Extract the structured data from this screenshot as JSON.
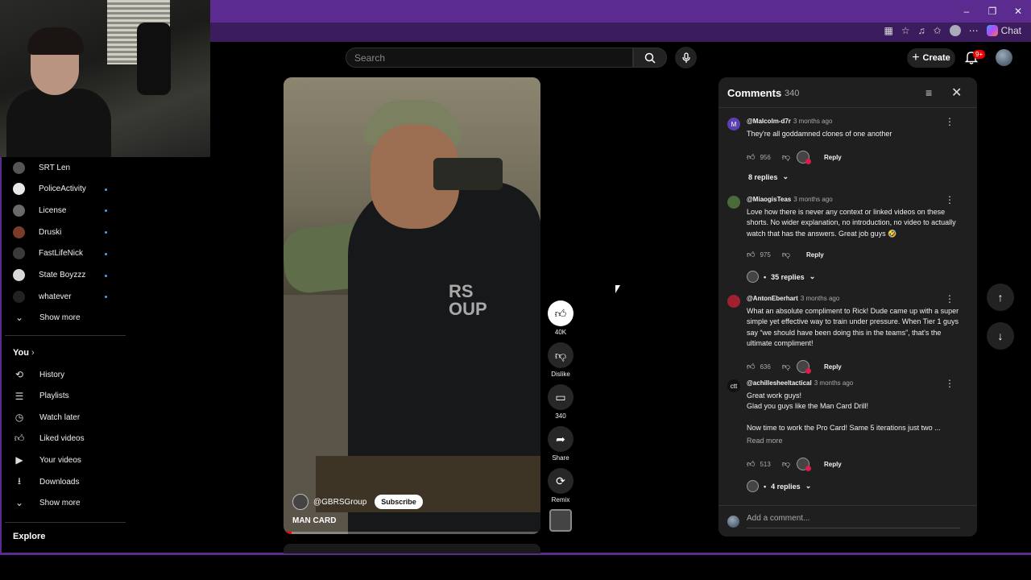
{
  "browser": {
    "window_controls": [
      "–",
      "❐",
      "✕"
    ],
    "chat_label": "Chat"
  },
  "header": {
    "search_placeholder": "Search",
    "create_label": "Create",
    "notification_badge": "9+"
  },
  "sidebar": {
    "subscriptions": [
      {
        "label": "SRT Len",
        "new": false,
        "color": "#555555"
      },
      {
        "label": "PoliceActivity",
        "new": true,
        "color": "#e8e8e8"
      },
      {
        "label": "License",
        "new": true,
        "color": "#6a6a6a"
      },
      {
        "label": "Druski",
        "new": true,
        "color": "#7a3b2a"
      },
      {
        "label": "FastLifeNick",
        "new": true,
        "color": "#3a3a3a"
      },
      {
        "label": "State Boyzzz",
        "new": true,
        "color": "#d8d8d8"
      },
      {
        "label": "whatever",
        "new": true,
        "color": "#222222"
      }
    ],
    "show_more_1": "Show more",
    "you_heading": "You",
    "you_items": [
      {
        "label": "History",
        "icon": "history-icon"
      },
      {
        "label": "Playlists",
        "icon": "playlists-icon"
      },
      {
        "label": "Watch later",
        "icon": "watch-later-icon"
      },
      {
        "label": "Liked videos",
        "icon": "thumbs-up-icon"
      },
      {
        "label": "Your videos",
        "icon": "your-videos-icon"
      },
      {
        "label": "Downloads",
        "icon": "download-icon"
      }
    ],
    "show_more_2": "Show more",
    "explore_heading": "Explore"
  },
  "video": {
    "channel": "@GBRSGroup",
    "subscribe_label": "Subscribe",
    "title": "MAN CARD",
    "overlay_text": "RS\nOUP",
    "progress": 0.03
  },
  "actions": {
    "likes": "40K",
    "dislike_label": "Dislike",
    "comments_count": "340",
    "share_label": "Share",
    "remix_label": "Remix"
  },
  "comments": {
    "title": "Comments",
    "count": "340",
    "items": [
      {
        "avatar_letter": "M",
        "avatar_color": "#5c3fb0",
        "author": "@Malcolm-d7r",
        "ago": "3 months ago",
        "text": "They're all goddamned clones of one another",
        "likes": "956",
        "creator_heart": true,
        "reply_label": "Reply",
        "replies": "8 replies"
      },
      {
        "avatar_letter": "",
        "avatar_color": "#4a6a3a",
        "author": "@MiaogisTeas",
        "ago": "3 months ago",
        "text": "Love how there is never any context or linked videos on these shorts. No wider explanation, no introduction, no video to actually watch that has the answers. Great job guys 🤣",
        "likes": "975",
        "creator_heart": false,
        "reply_label": "Reply",
        "replies": "35 replies"
      },
      {
        "avatar_letter": "",
        "avatar_color": "#a02030",
        "author": "@AntonEberhart",
        "ago": "3 months ago",
        "text": "What an absolute compliment to Rick! Dude came up with a super simple yet effective way to train under pressure. When Tier 1 guys say “we should have been doing this in the teams”, that's the ultimate compliment!",
        "likes": "636",
        "creator_heart": true,
        "reply_label": "Reply"
      },
      {
        "avatar_letter": "ctt",
        "avatar_color": "#111111",
        "author": "@achillesheeltactical",
        "ago": "3 months ago",
        "text_lines": [
          "Great work guys!",
          "Glad you guys like the Man Card Drill!",
          "",
          "Now time to work the Pro Card! Same 5 iterations just two ..."
        ],
        "read_more": "Read more",
        "likes": "513",
        "creator_heart": true,
        "reply_label": "Reply",
        "replies": "4 replies"
      }
    ],
    "add_placeholder": "Add a comment..."
  }
}
